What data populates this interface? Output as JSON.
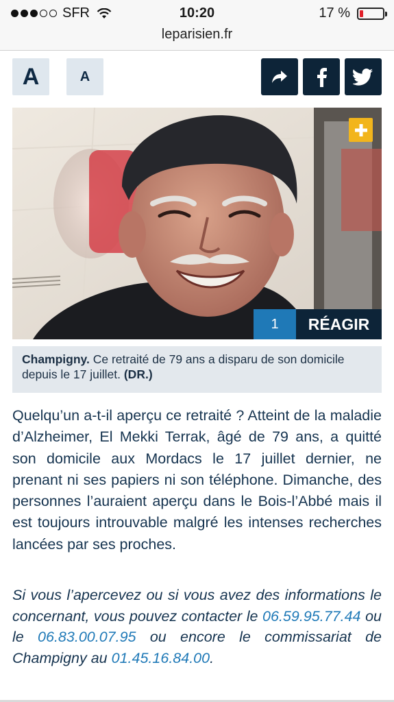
{
  "status_bar": {
    "carrier": "SFR",
    "time": "10:20",
    "battery_percent": "17 %",
    "battery_level": 0.17,
    "signal_bars_filled": 3,
    "signal_bars_total": 5
  },
  "url": "leparisien.fr",
  "toolbar": {
    "font_large_label": "A",
    "font_small_label": "A"
  },
  "photo": {
    "reactions_count": "1",
    "react_label": "RÉAGIR"
  },
  "caption": {
    "location": "Champigny.",
    "text": " Ce retraité de 79 ans a disparu de son domicile depuis le 17 juillet. ",
    "credit": "(DR.)"
  },
  "article": {
    "paragraph": "Quelqu’un a-t-il aperçu ce retraité ? Atteint de la maladie d’Alzheimer, El Mekki Terrak, âgé de 79 ans, a quitté son domicile aux Mordacs le 17 juillet dernier, ne prenant ni ses papiers ni son téléphone. Dimanche, des personnes l’auraient aperçu dans le Bois-l’Abbé mais il est toujours introuvable malgré les intenses recherches lancées par ses proches.",
    "info_intro": "Si vous l’apercevez ou si vous avez des informations le concernant, vous pouvez contacter le ",
    "phone1": "06.59.95.77.44",
    "info_or": " ou le ",
    "phone2": "06.83.00.07.95",
    "info_mid": " ou encore le commissariat de Champigny au ",
    "phone3": "01.45.16.84.00",
    "info_end": "."
  },
  "colors": {
    "navy": "#0d2438",
    "accent_blue": "#1f79b7",
    "plus_yellow": "#f2b51c"
  }
}
